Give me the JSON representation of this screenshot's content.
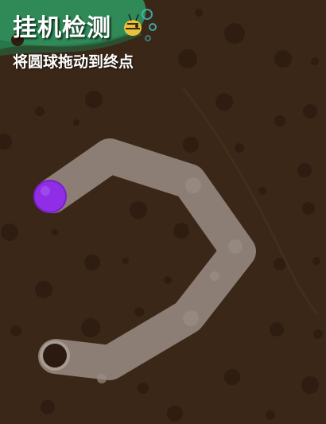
{
  "dialog": {
    "title": "挂机检测",
    "instruction": "将圆球拖动到终点"
  },
  "colors": {
    "dirt": "#3a2616",
    "header_green": "#2e8b57",
    "path": "#8c7e74",
    "ball": "#8e2de2",
    "goal_ring": "#a99a90",
    "goal_hole": "#2b1a0f"
  },
  "icons": {
    "bee": "bee-icon"
  }
}
